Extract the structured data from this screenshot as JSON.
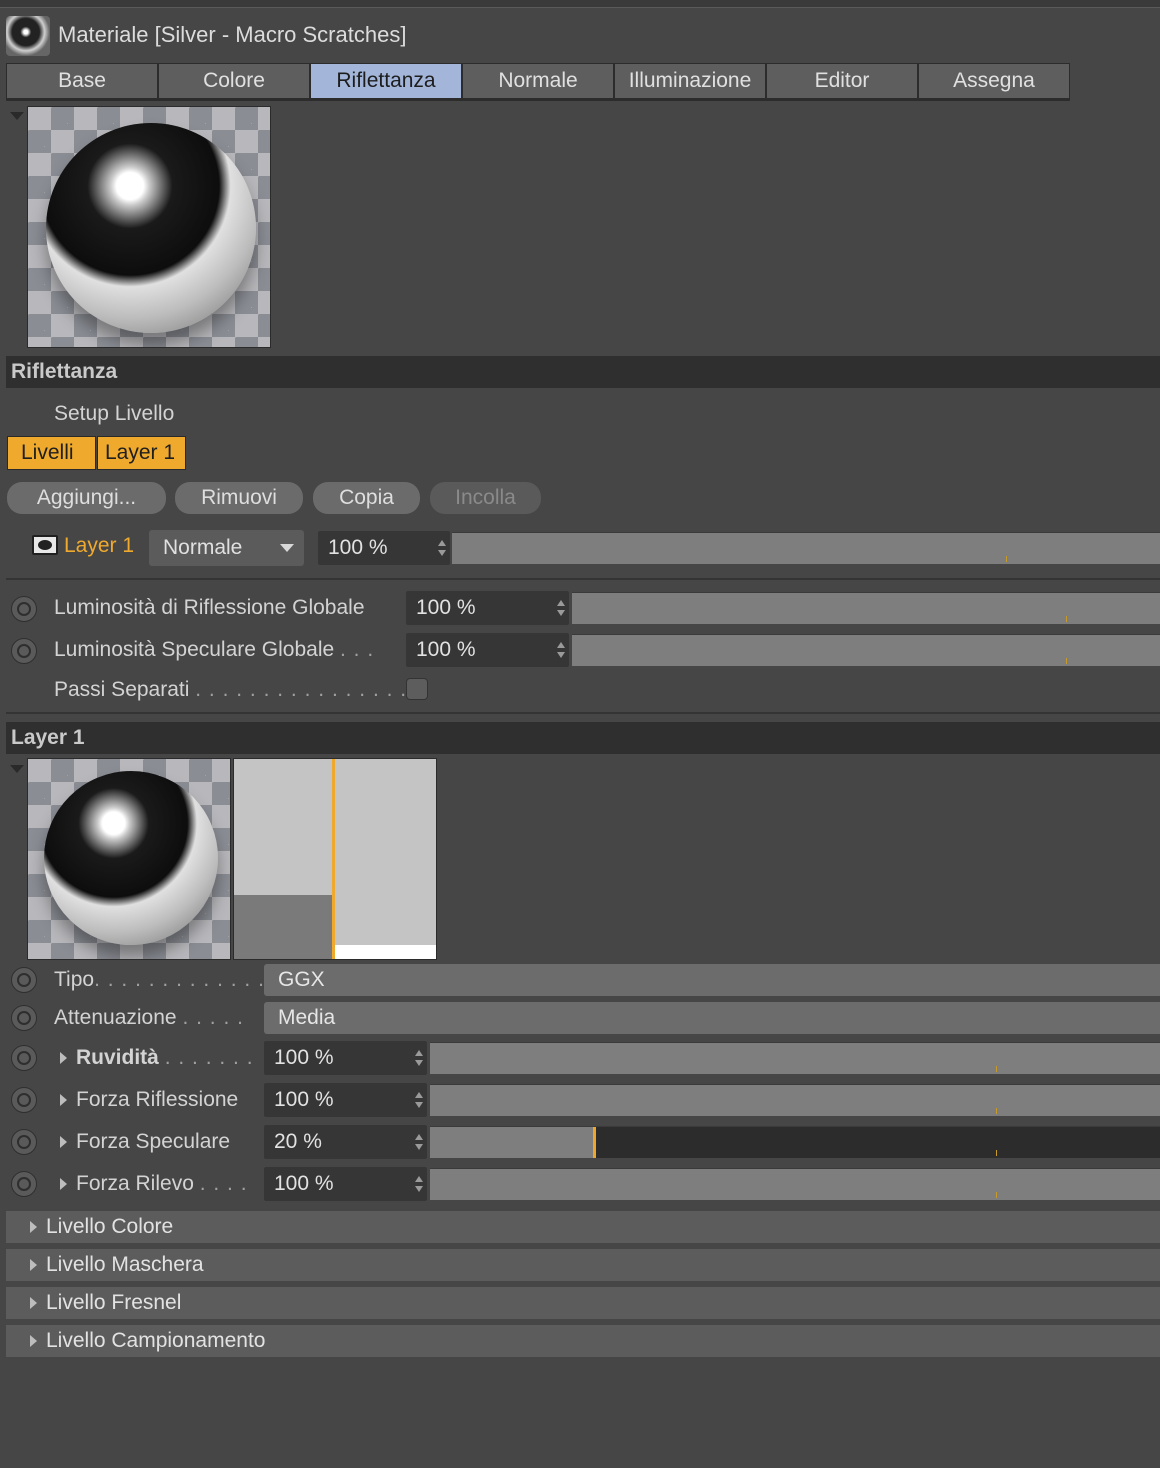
{
  "window": {
    "title": "Materiale [Silver - Macro Scratches]"
  },
  "tabs": [
    "Base",
    "Colore",
    "Riflettanza",
    "Normale",
    "Illuminazione",
    "Editor",
    "Assegna"
  ],
  "active_tab": "Riflettanza",
  "reflectance": {
    "header": "Riflettanza",
    "setup_label": "Setup Livello",
    "layer_tabs": [
      "Livelli",
      "Layer 1"
    ],
    "buttons": {
      "add": "Aggiungi...",
      "remove": "Rimuovi",
      "copy": "Copia",
      "paste": "Incolla"
    },
    "layer_row": {
      "name": "Layer 1",
      "blend_mode": "Normale",
      "opacity": "100 %",
      "opacity_level": 1.0
    },
    "params": [
      {
        "label": "Luminosità di Riflessione Globale",
        "value": "100 %",
        "level": 1.0
      },
      {
        "label": "Luminosità Speculare Globale",
        "value": "100 %",
        "level": 1.0
      }
    ],
    "separate_passes": {
      "label": "Passi Separati",
      "checked": false
    }
  },
  "layer1": {
    "header": "Layer 1",
    "type": {
      "label": "Tipo",
      "value": "GGX"
    },
    "attenuation": {
      "label": "Attenuazione",
      "value": "Media"
    },
    "params": [
      {
        "label": "Ruvidità",
        "value": "100 %",
        "level": 1.0,
        "bold": true
      },
      {
        "label": "Forza Riflessione",
        "value": "100 %",
        "level": 1.0
      },
      {
        "label": "Forza Speculare",
        "value": "20 %",
        "level": 0.2
      },
      {
        "label": "Forza Rilevo",
        "value": "100 %",
        "level": 1.0
      }
    ]
  },
  "groups": [
    "Livello Colore",
    "Livello Maschera",
    "Livello Fresnel",
    "Livello Campionamento"
  ],
  "colors": {
    "accent": "#efaa2e",
    "active_tab": "#a3b6d9",
    "background": "#464646"
  }
}
